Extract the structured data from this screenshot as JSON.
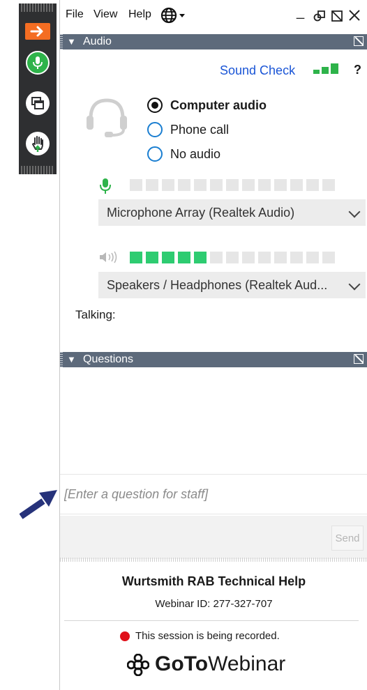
{
  "menu": {
    "file": "File",
    "view": "View",
    "help": "Help"
  },
  "audio": {
    "header": "Audio",
    "sound_check": "Sound Check",
    "help_mark": "?",
    "options": [
      {
        "label": "Computer audio",
        "selected": true
      },
      {
        "label": "Phone call",
        "selected": false
      },
      {
        "label": "No audio",
        "selected": false
      }
    ],
    "microphone": {
      "device": "Microphone Array (Realtek Audio)",
      "level_segments_on": 0,
      "level_segments_total": 13
    },
    "speakers": {
      "device": "Speakers / Headphones (Realtek Aud...",
      "level_segments_on": 5,
      "level_segments_total": 13
    },
    "talking_label": "Talking:"
  },
  "questions": {
    "header": "Questions",
    "input_placeholder": "[Enter a question for staff]",
    "send_label": "Send"
  },
  "footer": {
    "webinar_title": "Wurtsmith RAB Technical Help",
    "webinar_id": "Webinar ID: 277-327-707",
    "recording_notice": "This session is being recorded.",
    "brand_goto": "GoTo",
    "brand_webinar": "Webinar"
  },
  "colors": {
    "header_bar": "#5d6a7b",
    "accent_orange": "#f46d22",
    "mic_green": "#2eb34a",
    "meter_green": "#2ecc71",
    "link_blue": "#1a55d6",
    "record_red": "#e0101a",
    "arrow_navy": "#26327a"
  },
  "icons": {
    "arrow_tab": "arrow-right-icon",
    "mic_tab": "microphone-icon",
    "screen_tab": "screen-share-icon",
    "hand_tab": "raise-hand-icon",
    "language": "globe-icon",
    "headset": "headset-icon",
    "brand": "goto-logo-icon"
  }
}
